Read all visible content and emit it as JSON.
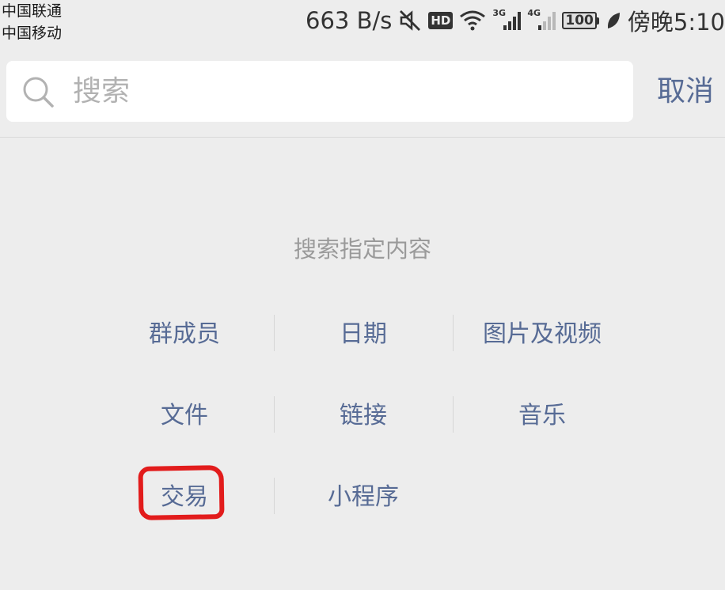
{
  "status_bar": {
    "carrier_1": "中国联通",
    "carrier_2": "中国移动",
    "net_speed": "663 B/s",
    "hd": "HD",
    "sim1_generation": "3G",
    "sim2_generation": "4G",
    "battery": "100",
    "time": "傍晚5:10",
    "icons": [
      "mute-icon",
      "hd-icon",
      "wifi-icon",
      "signal-3g-icon",
      "signal-4g-icon",
      "battery-icon",
      "leaf-icon"
    ]
  },
  "search": {
    "placeholder": "搜索",
    "value": "",
    "cancel_label": "取消"
  },
  "section": {
    "title": "搜索指定内容",
    "categories": [
      {
        "label": "群成员"
      },
      {
        "label": "日期"
      },
      {
        "label": "图片及视频"
      },
      {
        "label": "文件"
      },
      {
        "label": "链接"
      },
      {
        "label": "音乐"
      },
      {
        "label": "交易"
      },
      {
        "label": "小程序"
      }
    ]
  },
  "annotation": {
    "highlighted_item": "交易",
    "color": "#e21c1c"
  },
  "colors": {
    "background": "#ededed",
    "link": "#576b95",
    "hint": "#9a9a9a"
  }
}
